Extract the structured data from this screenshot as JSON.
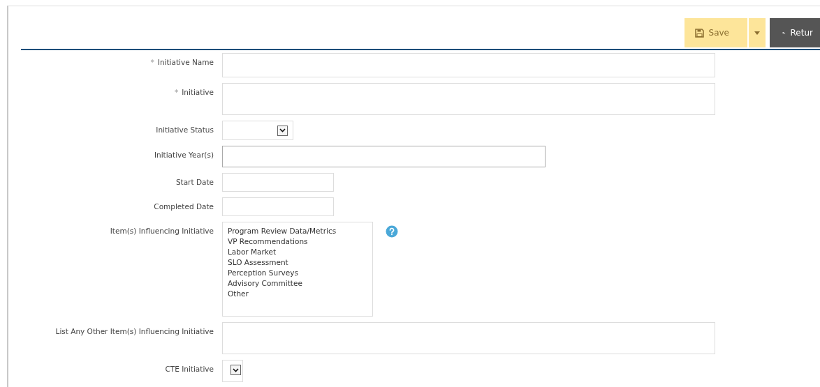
{
  "toolbar": {
    "save": {
      "label": "Save"
    },
    "return": {
      "label": "Retur"
    }
  },
  "fields": [
    {
      "kind": "text",
      "label": "Initiative Name",
      "marker": "*"
    },
    {
      "kind": "textarea",
      "label": "Initiative",
      "marker": "*"
    },
    {
      "kind": "select",
      "label": "Initiative Status"
    },
    {
      "kind": "wide",
      "label": "Initiative Year(s)"
    },
    {
      "kind": "date",
      "label": "Start Date"
    },
    {
      "kind": "date",
      "label": "Completed Date"
    },
    {
      "kind": "listbox",
      "label": "Item(s) Influencing Initiative",
      "help": true,
      "options": [
        "Program Review Data/Metrics",
        "VP Recommendations",
        "Labor Market",
        "SLO Assessment",
        "Perception Surveys",
        "Advisory Committee",
        "Other"
      ]
    },
    {
      "kind": "textarea",
      "label": "List Any Other Item(s) Influencing Initiative"
    },
    {
      "kind": "select-small",
      "label": "CTE Initiative"
    }
  ]
}
